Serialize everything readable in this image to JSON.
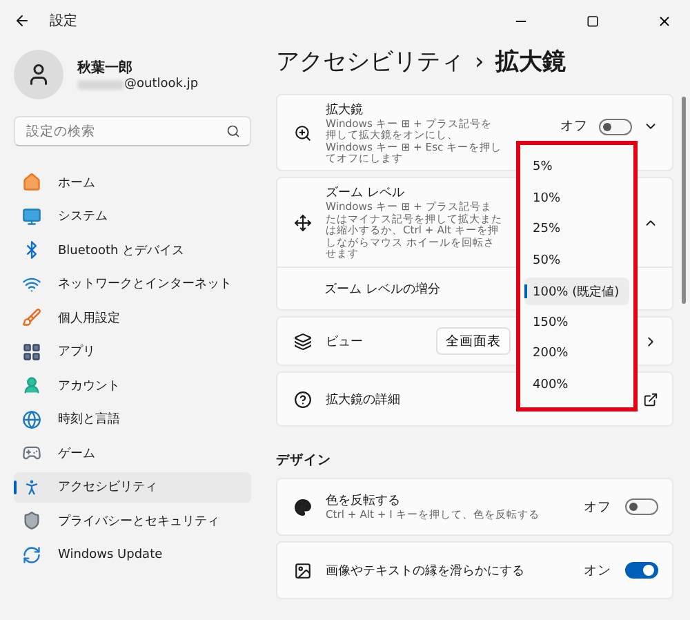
{
  "window": {
    "title": "設定"
  },
  "profile": {
    "name": "秋葉一郎",
    "email": "@outlook.jp"
  },
  "search": {
    "placeholder": "設定の検索"
  },
  "nav": [
    {
      "label": "ホーム",
      "selected": false
    },
    {
      "label": "システム",
      "selected": false
    },
    {
      "label": "Bluetooth とデバイス",
      "selected": false
    },
    {
      "label": "ネットワークとインターネット",
      "selected": false
    },
    {
      "label": "個人用設定",
      "selected": false
    },
    {
      "label": "アプリ",
      "selected": false
    },
    {
      "label": "アカウント",
      "selected": false
    },
    {
      "label": "時刻と言語",
      "selected": false
    },
    {
      "label": "ゲーム",
      "selected": false
    },
    {
      "label": "アクセシビリティ",
      "selected": true
    },
    {
      "label": "プライバシーとセキュリティ",
      "selected": false
    },
    {
      "label": "Windows Update",
      "selected": false
    }
  ],
  "breadcrumb": {
    "parent": "アクセシビリティ",
    "separator": "›",
    "current": "拡大鏡"
  },
  "magnifier": {
    "title": "拡大鏡",
    "description": "Windows キー ⊞ + プラス記号を押して拡大鏡をオンにし、Windows キー ⊞ + Esc キーを押してオフにします",
    "state_label": "オフ",
    "on": false,
    "expanded": false
  },
  "zoom_level": {
    "title": "ズーム レベル",
    "description": "Windows キー ⊞ + プラス記号またはマイナス記号を押して拡大または縮小するか、Ctrl + Alt キーを押しながらマウス ホイールを回転させます",
    "expanded": true,
    "increment_label": "ズーム レベルの増分"
  },
  "view": {
    "label": "ビュー",
    "value": "全画面表"
  },
  "details": {
    "label": "拡大鏡の詳細"
  },
  "design": {
    "heading": "デザイン",
    "items": [
      {
        "title": "色を反転する",
        "description": "Ctrl + Alt + I キーを押して、色を反転する",
        "state_label": "オフ",
        "on": false
      },
      {
        "title": "画像やテキストの縁を滑らかにする",
        "state_label": "オン",
        "on": true
      }
    ]
  },
  "dropdown": {
    "options": [
      {
        "label": "5%",
        "selected": false
      },
      {
        "label": "10%",
        "selected": false
      },
      {
        "label": "25%",
        "selected": false
      },
      {
        "label": "50%",
        "selected": false
      },
      {
        "label": "100% (既定値)",
        "selected": true
      },
      {
        "label": "150%",
        "selected": false
      },
      {
        "label": "200%",
        "selected": false
      },
      {
        "label": "400%",
        "selected": false
      }
    ]
  }
}
